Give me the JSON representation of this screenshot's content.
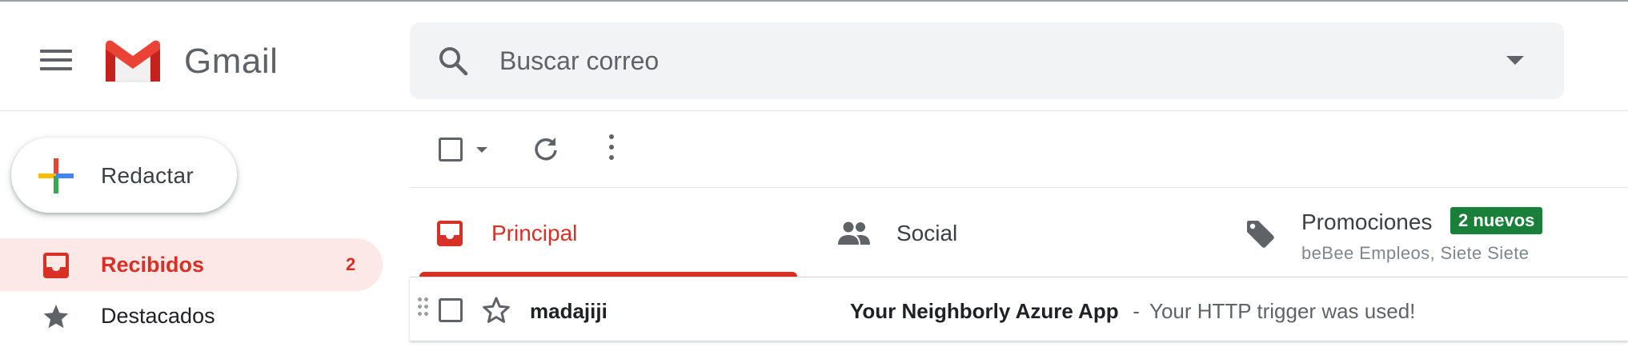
{
  "app": {
    "name": "Gmail"
  },
  "colors": {
    "accent": "#d93025",
    "badge": "#188038",
    "selected_bg": "#fce8e6",
    "search_bg": "#f1f3f4"
  },
  "icons": [
    "menu-icon",
    "gmail-logo",
    "search-icon",
    "dropdown-caret-icon",
    "plus-icon",
    "inbox-icon",
    "star-icon",
    "checkbox-icon",
    "refresh-icon",
    "more-vert-icon",
    "people-icon",
    "tag-icon",
    "drag-handle-icon"
  ],
  "search": {
    "placeholder": "Buscar correo",
    "value": ""
  },
  "compose": {
    "label": "Redactar"
  },
  "nav": [
    {
      "label": "Recibidos",
      "count": "2",
      "selected": true
    },
    {
      "label": "Destacados"
    }
  ],
  "tabs": [
    {
      "label": "Principal",
      "selected": true
    },
    {
      "label": "Social"
    },
    {
      "label": "Promociones",
      "badge": "2 nuevos",
      "subtitle": "beBee Empleos, Siete Siete"
    }
  ],
  "emails": [
    {
      "sender": "madajiji",
      "subject": "Your Neighborly Azure App",
      "separator": " - ",
      "snippet": "Your HTTP trigger was used!",
      "starred": false
    }
  ]
}
